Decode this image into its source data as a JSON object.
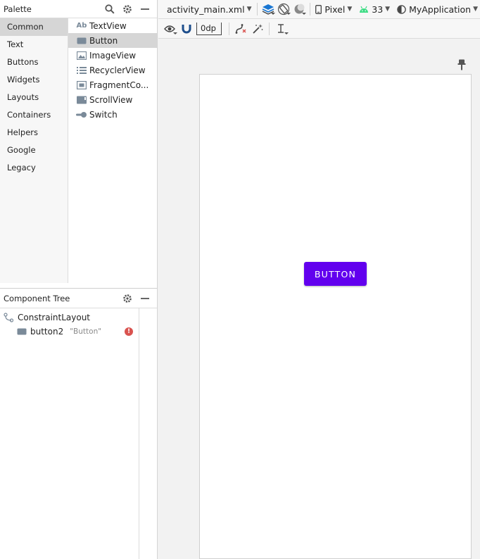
{
  "palette": {
    "title": "Palette",
    "categories": [
      "Common",
      "Text",
      "Buttons",
      "Widgets",
      "Layouts",
      "Containers",
      "Helpers",
      "Google",
      "Legacy"
    ],
    "widgets": [
      {
        "label": "TextView",
        "icon": "textview-icon",
        "icon_text": "Ab"
      },
      {
        "label": "Button",
        "icon": "button-icon"
      },
      {
        "label": "ImageView",
        "icon": "imageview-icon"
      },
      {
        "label": "RecyclerView",
        "icon": "recyclerview-icon"
      },
      {
        "label": "FragmentCo...",
        "icon": "fragment-icon"
      },
      {
        "label": "ScrollView",
        "icon": "scrollview-icon"
      },
      {
        "label": "Switch",
        "icon": "switch-icon"
      }
    ]
  },
  "component_tree": {
    "title": "Component Tree",
    "root": "ConstraintLayout",
    "child": {
      "name": "button2",
      "hint": "\"Button\"",
      "error_glyph": "!"
    }
  },
  "toolbar": {
    "file": "activity_main.xml",
    "device": "Pixel",
    "api": "33",
    "app": "MyApplication",
    "margin": "0dp"
  },
  "preview": {
    "button_text": "BUTTON",
    "accent": "#6200ee"
  }
}
